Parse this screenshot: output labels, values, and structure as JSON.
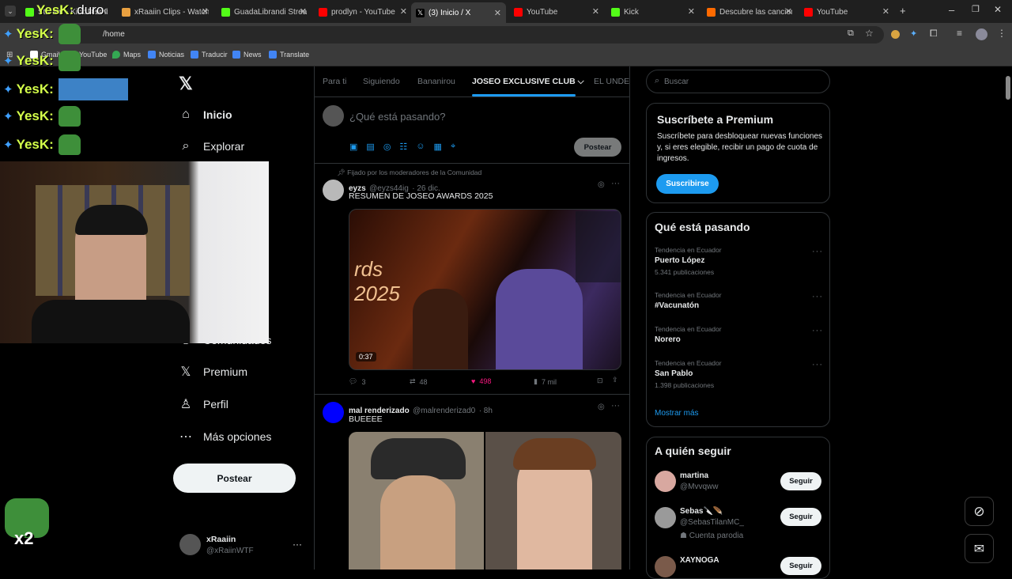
{
  "tabs": [
    {
      "label": "Stream - Kick Dashbo",
      "color": "#53fc18"
    },
    {
      "label": "xRaaiin Clips - Watch",
      "color": "#e8a040"
    },
    {
      "label": "GuadaLibrandi Stream",
      "color": "#53fc18"
    },
    {
      "label": "prodlyn - YouTube",
      "color": "#ff0000"
    },
    {
      "label": "(3) Inicio / X",
      "color": "#ffffff"
    },
    {
      "label": "YouTube",
      "color": "#ff0000"
    },
    {
      "label": "Kick",
      "color": "#53fc18"
    },
    {
      "label": "Descubre las cancion",
      "color": "#ff6a00"
    },
    {
      "label": "YouTube",
      "color": "#ff0000"
    }
  ],
  "address": {
    "url": "/home"
  },
  "bookmarks": [
    "Gmail",
    "YouTube",
    "Maps",
    "Noticias",
    "Traducir",
    "News",
    "Translate"
  ],
  "overlay": {
    "yesk_text": "YesK:",
    "duro": "duro",
    "multiplier": "x2"
  },
  "nav": {
    "items": [
      "Inicio",
      "Explorar",
      "Comunidades",
      "Premium",
      "Perfil",
      "Más opciones"
    ],
    "post_button": "Postear",
    "account": {
      "name": "xRaaiin",
      "handle": "@xRaiinWTF"
    }
  },
  "center": {
    "tabs": [
      "Para ti",
      "Siguiendo",
      "Bananirou",
      "JOSEO EXCLUSIVE CLUB",
      "EL UNDER"
    ],
    "composer_placeholder": "¿Qué está pasando?",
    "composer_button": "Postear",
    "pinned_label": "Fijado por los moderadores de la Comunidad",
    "tweet1": {
      "name": "eyzs",
      "handle": "@eyzs44ig",
      "time": "· 26 dic.",
      "text": "RESUMEN DE JOSEO AWARDS 2025",
      "video_time": "0:37",
      "video_overlay": "rds 2025",
      "replies": "3",
      "retweets": "48",
      "likes": "498",
      "views": "7 mil"
    },
    "tweet2": {
      "name": "mal renderizado",
      "handle": "@malrenderizad0",
      "time": "· 8h",
      "text": "BUEEEE"
    }
  },
  "right": {
    "search_placeholder": "Buscar",
    "premium": {
      "title": "Suscríbete a Premium",
      "body": "Suscríbete para desbloquear nuevas funciones y, si eres elegible, recibir un pago de cuota de ingresos.",
      "button": "Suscribirse"
    },
    "trends": {
      "title": "Qué está pasando",
      "items": [
        {
          "context": "Tendencia en Ecuador",
          "name": "Puerto López",
          "count": "5.341 publicaciones"
        },
        {
          "context": "Tendencia en Ecuador",
          "name": "#Vacunatón",
          "count": ""
        },
        {
          "context": "Tendencia en Ecuador",
          "name": "Norero",
          "count": ""
        },
        {
          "context": "Tendencia en Ecuador",
          "name": "San Pablo",
          "count": "1.398 publicaciones"
        }
      ],
      "more": "Mostrar más"
    },
    "follow": {
      "title": "A quién seguir",
      "items": [
        {
          "name": "martina",
          "handle": "@Mvvqww",
          "extra": ""
        },
        {
          "name": "Sebas🔪🪶",
          "handle": "@SebasTilanMC_",
          "extra": "Cuenta parodia"
        },
        {
          "name": "XAYNOGA",
          "handle": "",
          "extra": ""
        }
      ],
      "button": "Seguir"
    }
  },
  "colors": {
    "accent": "#1d9bf0",
    "like": "#f91880",
    "pepe": "#3e8f3a"
  }
}
